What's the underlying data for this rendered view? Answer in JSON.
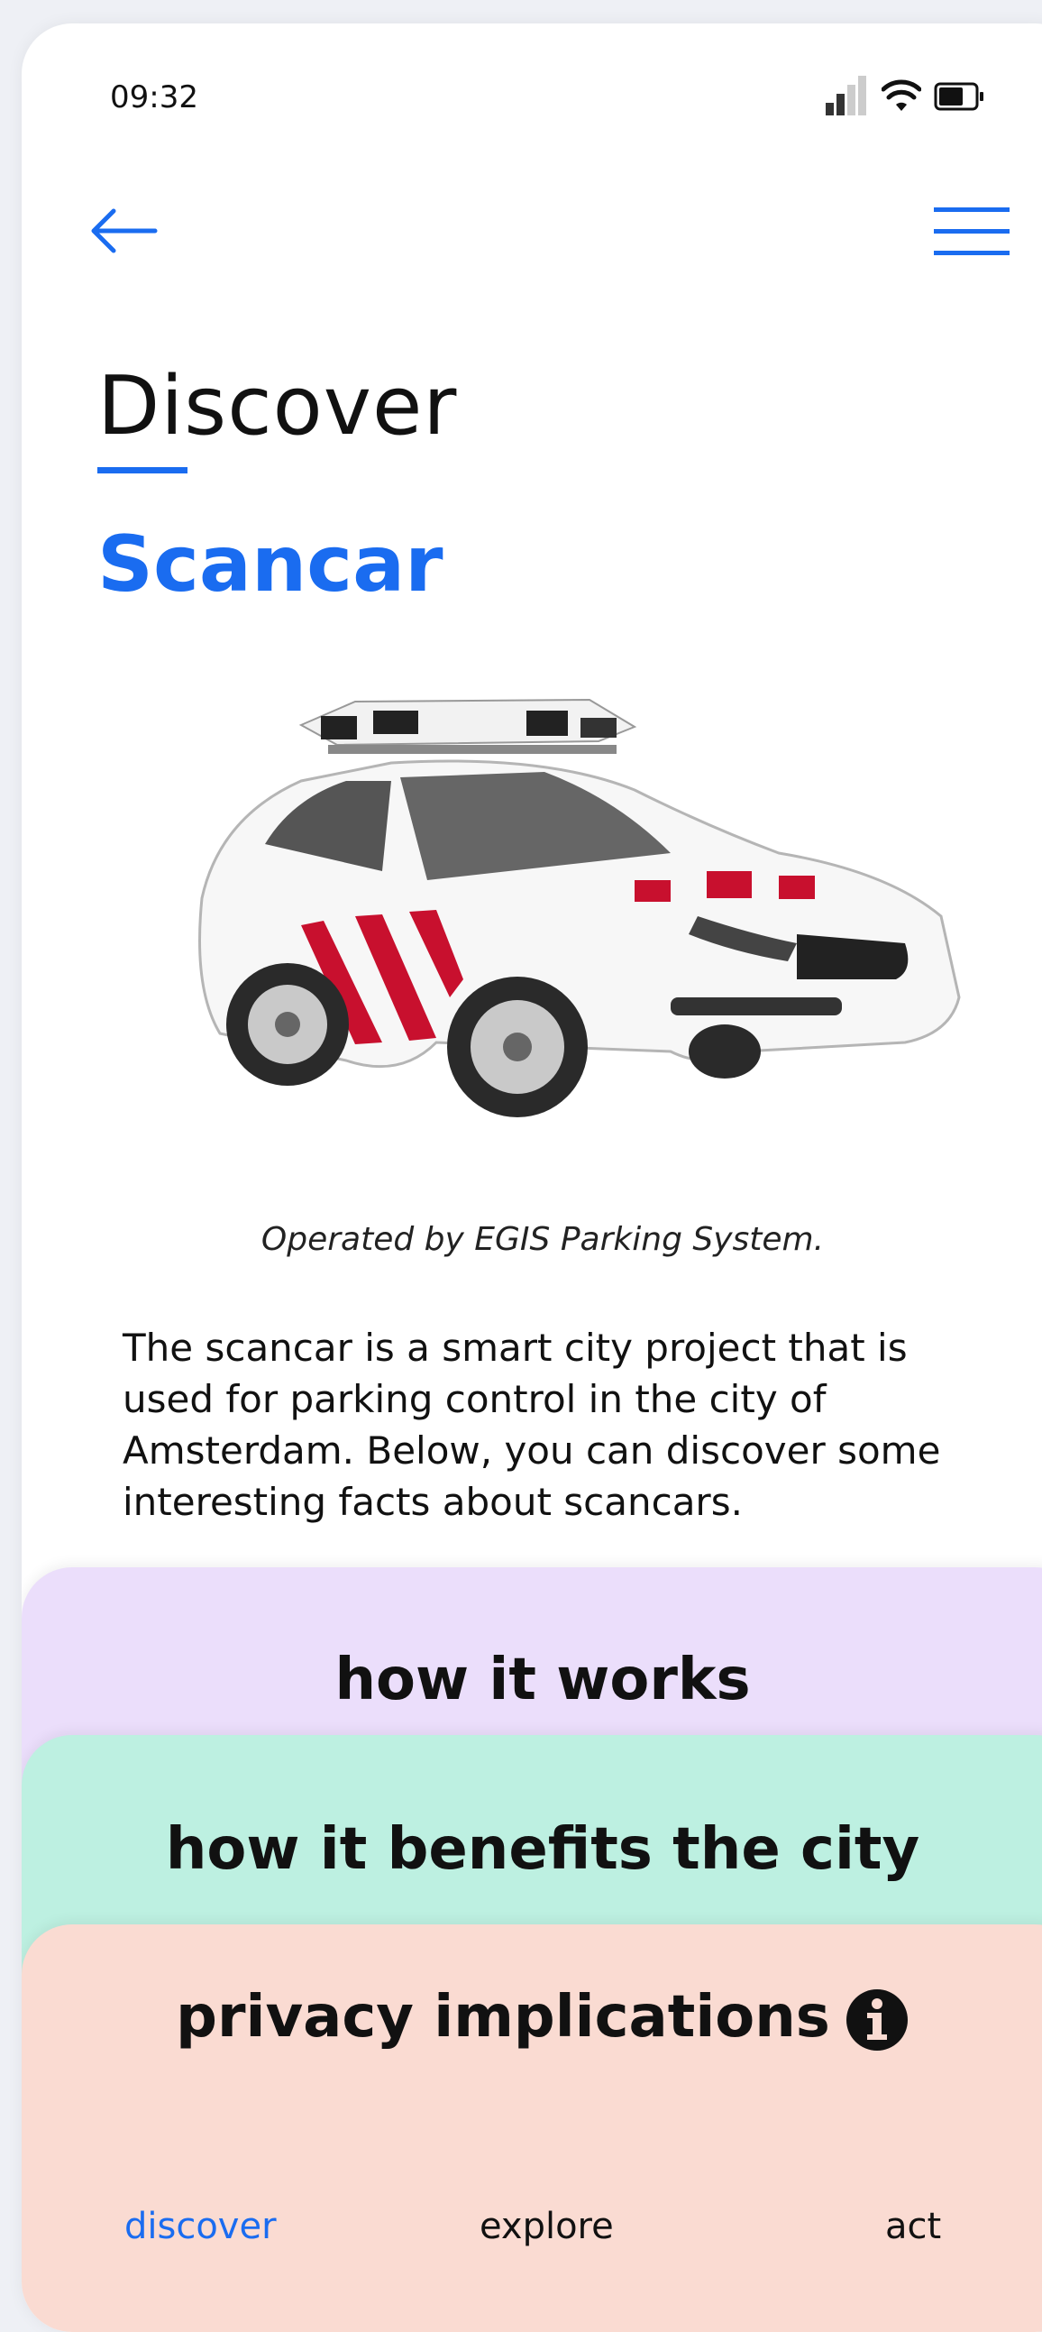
{
  "status_bar": {
    "time": "09:32",
    "icons": [
      "signal-icon",
      "wifi-icon",
      "battery-icon"
    ]
  },
  "header": {
    "back_icon": "arrow-left-icon",
    "menu_icon": "hamburger-menu-icon"
  },
  "page": {
    "title": "Discover",
    "subtitle": "Scancar",
    "caption": "Operated by EGIS Parking System.",
    "description": "The scancar is a smart city project that is used for parking control in the city of Amsterdam. Below, you can discover some interesting facts about scancars."
  },
  "cards": [
    {
      "label": "how it works",
      "color": "#ebdefb"
    },
    {
      "label": "how it benefits the city",
      "color": "#bdf0e1"
    },
    {
      "label": "privacy implications",
      "color": "#fadbd2",
      "icon": "info-icon"
    }
  ],
  "bottom_nav": {
    "items": [
      {
        "label": "discover",
        "active": true
      },
      {
        "label": "explore",
        "active": false
      },
      {
        "label": "act",
        "active": false
      }
    ]
  },
  "colors": {
    "accent": "#1a6cf0",
    "text": "#111111"
  }
}
